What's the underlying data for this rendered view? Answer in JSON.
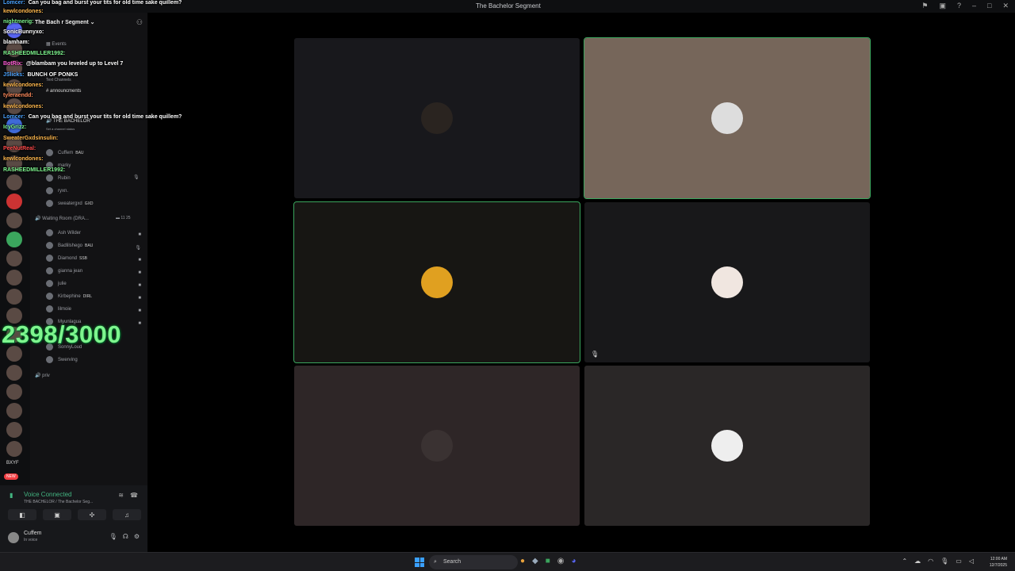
{
  "window": {
    "title": "The Bachelor Segment"
  },
  "server": {
    "name_fragment": "The Bach",
    "name_tail": "r Segment",
    "events_label": "Events",
    "text_channels": "Text Channels",
    "announcements": "announcments",
    "voice_channel_bachelor": "THE BACHELOR",
    "channel_status": "Set a channel status"
  },
  "channel_members": [
    {
      "name": "Cuffem",
      "badge": "BAU"
    },
    {
      "name": "marky",
      "badge": ""
    },
    {
      "name": "Rubin",
      "badge": ""
    },
    {
      "name": "ryxn.",
      "badge": ""
    },
    {
      "name": "sweatergxd",
      "badge": "GXD"
    }
  ],
  "waiting_room": {
    "label": "Waiting Room (DRA...",
    "count_a": "11",
    "count_b": "25"
  },
  "waiting_members": [
    {
      "name": "Ash Wilder",
      "badge": ""
    },
    {
      "name": "Badlilshego",
      "badge": "BAU"
    },
    {
      "name": "Diamond",
      "badge": "SSB"
    },
    {
      "name": "gianna jean",
      "badge": ""
    },
    {
      "name": "julie",
      "badge": ""
    },
    {
      "name": "Kirbephine",
      "badge": "DIRL"
    },
    {
      "name": "lilmoie",
      "badge": ""
    },
    {
      "name": "Myunlagua",
      "badge": ""
    },
    {
      "name": "",
      "badge": ""
    },
    {
      "name": "SonnyLoud",
      "badge": ""
    },
    {
      "name": "Swerving",
      "badge": ""
    }
  ],
  "priv_label": "priv",
  "chat": [
    {
      "user": "Lomcer:",
      "msg": "Can you bag and burst your tits for old time sake quillem?",
      "color": "#4aa3ff"
    },
    {
      "user": "kewlcondones:",
      "msg": "",
      "color": "#ffb84d"
    },
    {
      "user": "nightmerig:",
      "msg": "",
      "color": "#7ef58e"
    },
    {
      "user": "SonicBunnyxo:",
      "msg": "",
      "color": "#ffffff"
    },
    {
      "user": "blamham:",
      "msg": "",
      "color": "#ffffff"
    },
    {
      "user": "RASHEEDMILLER1992:",
      "msg": "",
      "color": "#7ef58e"
    },
    {
      "user": "BotRix:",
      "msg": "@blambam you leveled up to Level 7",
      "color": "#ff5bd6"
    },
    {
      "user": "JSlicks:",
      "msg": "BUNCH OF PONKS",
      "color": "#4aa3ff"
    },
    {
      "user": "kewlcondones:",
      "msg": "",
      "color": "#ffb84d"
    },
    {
      "user": "tyleraendd:",
      "msg": "",
      "color": "#ff8a5b"
    },
    {
      "user": "kewlcondones:",
      "msg": "",
      "color": "#ffb84d"
    },
    {
      "user": "Lomcer:",
      "msg": "Can you bag and burst your tits for old time sake quillem?",
      "color": "#4aa3ff"
    },
    {
      "user": "IcyGrizz:",
      "msg": "",
      "color": "#7ef58e"
    },
    {
      "user": "SweaterGxdsinsulin:",
      "msg": "",
      "color": "#ffb84d"
    },
    {
      "user": "PeeNutReal:",
      "msg": "",
      "color": "#ff4a4a"
    },
    {
      "user": "kewlcondones:",
      "msg": "",
      "color": "#ffb84d"
    },
    {
      "user": "RASHEEDMILLER1992:",
      "msg": "",
      "color": "#7ef58e"
    }
  ],
  "counter": "2398/3000",
  "voice": {
    "connected_label": "Voice Connected",
    "location": "THE BACHELOR / The Bachelor Seg..."
  },
  "user": {
    "name": "Cuffem",
    "status": "In voice"
  },
  "servers_label": "BXYF",
  "new_badge": "NEW",
  "taskbar": {
    "search_label": "Search",
    "time": "12:00 AM",
    "date": "12/7/2025"
  }
}
